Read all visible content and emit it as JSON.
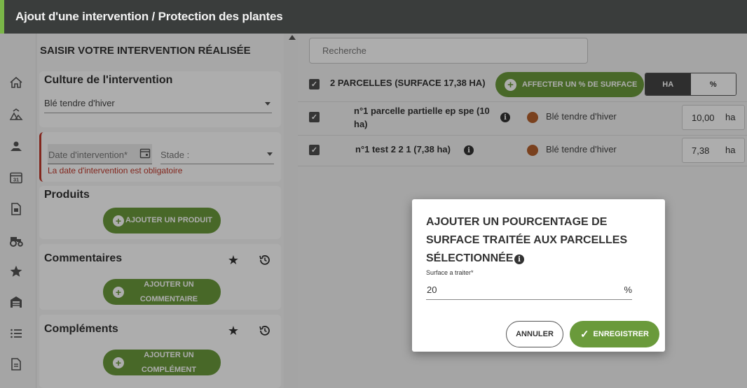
{
  "header": {
    "title": "Ajout d'une intervention / Protection des plantes"
  },
  "rail": {
    "icons": [
      "home-icon",
      "field-icon",
      "plot-icon",
      "calendar-icon",
      "document-icon",
      "tractor-icon",
      "star-icon",
      "warehouse-icon",
      "list-icon",
      "report-icon"
    ]
  },
  "form": {
    "heading": "SAISIR VOTRE INTERVENTION RÉALISÉE",
    "culture": {
      "title": "Culture de l'intervention",
      "value": "Blé tendre d'hiver"
    },
    "date": {
      "placeholder": "Date d'intervention*",
      "stade_placeholder": "Stade :",
      "error": "La date d'intervention est obligatoire"
    },
    "produits": {
      "title": "Produits",
      "button": "AJOUTER UN PRODUIT"
    },
    "commentaires": {
      "title": "Commentaires",
      "button": "AJOUTER UN COMMENTAIRE"
    },
    "complements": {
      "title": "Compléments",
      "button": "AJOUTER UN COMPLÉMENT"
    }
  },
  "parcels": {
    "search_placeholder": "Recherche",
    "selection_label": "2 PARCELLES (SURFACE 17,38 HA)",
    "affect_button": "AFFECTER UN % DE SURFACE",
    "toggle": {
      "ha": "HA",
      "pct": "%",
      "selected": "HA"
    },
    "rows": [
      {
        "name_line1": "n°1 parcelle partielle ep spe (10",
        "name_line2": "ha)",
        "crop": "Blé tendre d'hiver",
        "area": "10,00",
        "unit": "ha"
      },
      {
        "name_line1": "n°1 test 2 2 1 (7,38 ha)",
        "name_line2": "",
        "crop": "Blé tendre d'hiver",
        "area": "7,38",
        "unit": "ha"
      }
    ],
    "crop_color": "#b4612d"
  },
  "dialog": {
    "title": "AJOUTER UN POURCENTAGE DE SURFACE TRAITÉE AUX PARCELLES SÉLECTIONNÉE",
    "field_label": "Surface a traiter*",
    "field_value": "20",
    "field_unit": "%",
    "cancel": "ANNULER",
    "save": "ENREGISTRER"
  },
  "colors": {
    "accent": "#6a9a3b",
    "header_bg": "#3a3d3c",
    "error": "#c0392b"
  }
}
